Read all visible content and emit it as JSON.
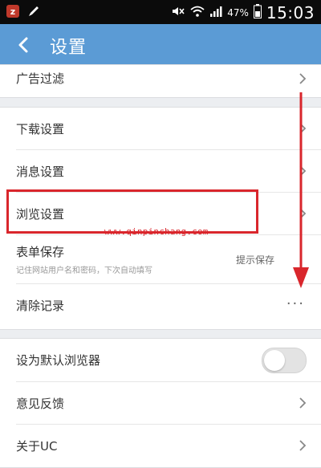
{
  "status_bar": {
    "battery": "47%",
    "time": "15:03",
    "icons": [
      "z-app-icon",
      "pen-icon",
      "mute-icon",
      "wifi-icon",
      "signal-icon",
      "battery-icon"
    ]
  },
  "header": {
    "title": "设置",
    "back_icon": "chevron-left-icon"
  },
  "groups": {
    "top": {
      "items": [
        {
          "label": "广告过滤"
        }
      ]
    },
    "settings": {
      "items": [
        {
          "label": "下载设置"
        },
        {
          "label": "消息设置"
        },
        {
          "label": "浏览设置"
        },
        {
          "label": "表单保存",
          "sublabel": "记住网站用户名和密码，下次自动填写",
          "value": "提示保存"
        },
        {
          "label": "清除记录",
          "more": "···"
        }
      ]
    },
    "bottom": {
      "items": [
        {
          "label": "设为默认浏览器",
          "toggle_on": false
        },
        {
          "label": "意见反馈"
        },
        {
          "label": "关于UC"
        }
      ]
    }
  },
  "annotation": {
    "watermark": "www.qinpinchang.com",
    "highlight_color": "#d9262c"
  },
  "colors": {
    "header": "#5b9bd5",
    "background": "#eceef1",
    "status_bar": "#0b0b0b"
  }
}
